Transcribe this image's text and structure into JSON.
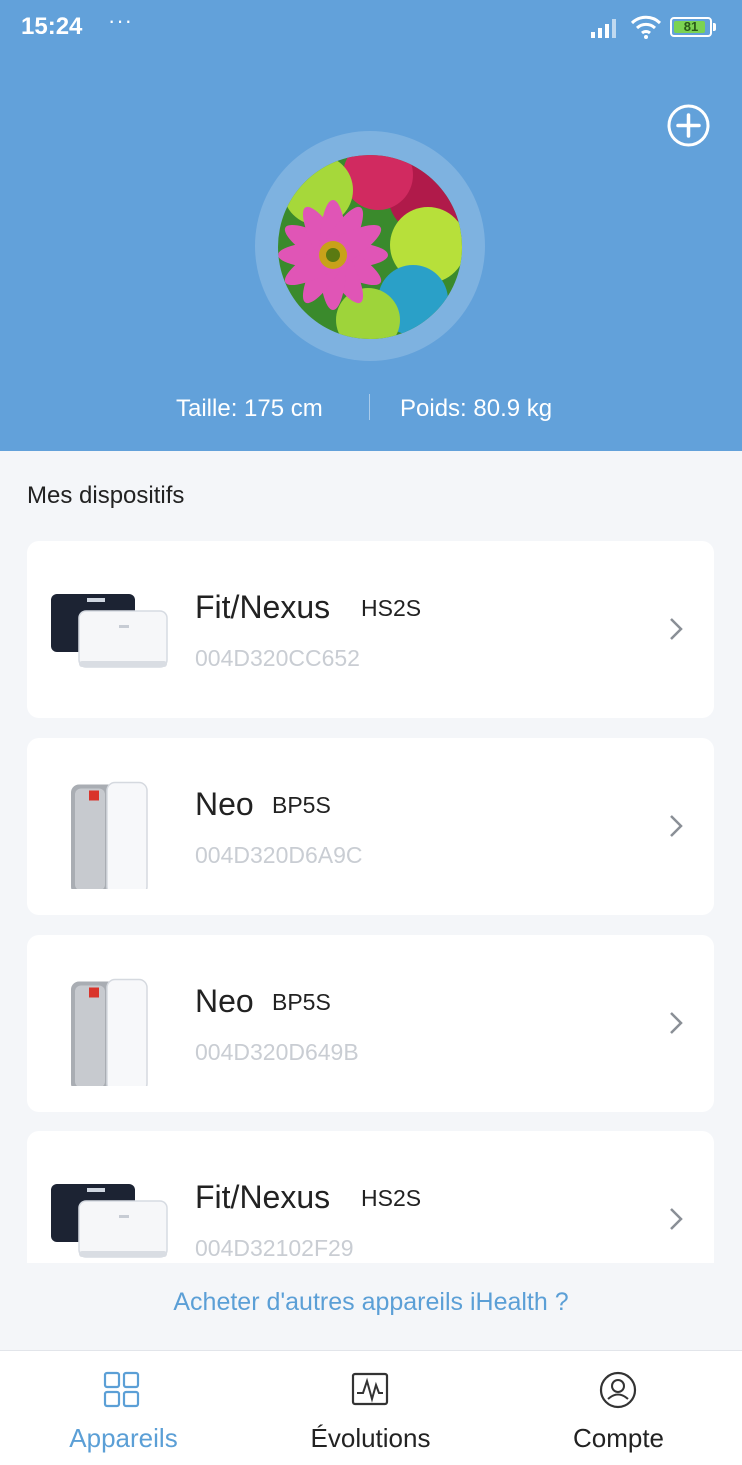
{
  "status_bar": {
    "time": "15:24",
    "dots": "···",
    "battery_level": "81"
  },
  "profile": {
    "height_text": "Taille: 175 cm",
    "weight_text": "Poids: 80.9 kg",
    "add_icon": "plus-circle-icon",
    "avatar": "flower-photo"
  },
  "section_title": "Mes dispositifs",
  "devices": [
    {
      "name": "Fit/Nexus",
      "model": "HS2S",
      "serial": "004D320CC652",
      "image": "scale-image"
    },
    {
      "name": "Neo",
      "model": "BP5S",
      "serial": "004D320D6A9C",
      "image": "blood-pressure-cuff-image"
    },
    {
      "name": "Neo",
      "model": "BP5S",
      "serial": "004D320D649B",
      "image": "blood-pressure-cuff-image"
    },
    {
      "name": "Fit/Nexus",
      "model": "HS2S",
      "serial": "004D32102F29",
      "image": "scale-image"
    }
  ],
  "buy_link": "Acheter d'autres appareils iHealth ?",
  "tabs": [
    {
      "label": "Appareils",
      "icon": "grid-icon",
      "active": true
    },
    {
      "label": "Évolutions",
      "icon": "chart-icon",
      "active": false
    },
    {
      "label": "Compte",
      "icon": "user-circle-icon",
      "active": false
    }
  ],
  "colors": {
    "header": "#62a1da",
    "accent": "#5b9fd6",
    "background": "#f4f6f9",
    "serial": "#c9cdd3"
  }
}
